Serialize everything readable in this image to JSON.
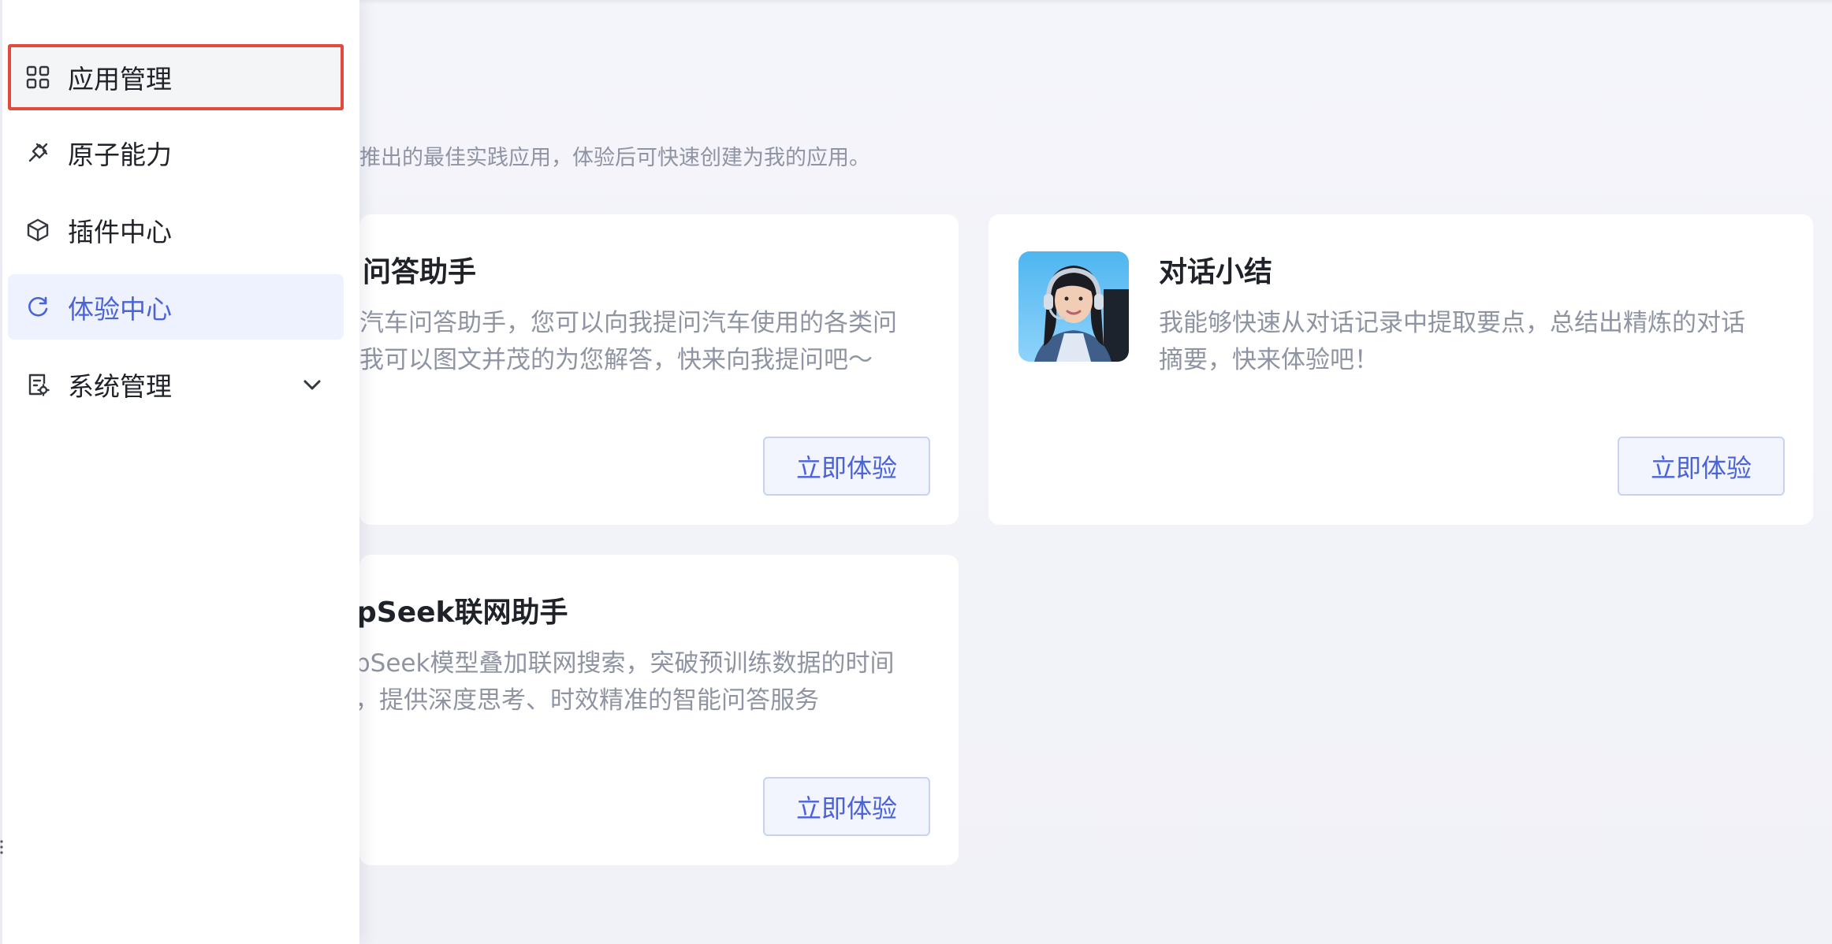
{
  "sidebar": {
    "items": [
      {
        "label": "应用管理",
        "icon": "grid-icon",
        "state": "highlighted"
      },
      {
        "label": "原子能力",
        "icon": "plug-icon",
        "state": "normal"
      },
      {
        "label": "插件中心",
        "icon": "cube-icon",
        "state": "normal"
      },
      {
        "label": "体验中心",
        "icon": "refresh-icon",
        "state": "active"
      },
      {
        "label": "系统管理",
        "icon": "settings-doc-icon",
        "state": "normal",
        "expandable": true
      }
    ]
  },
  "main": {
    "subtitle": "推出的最佳实践应用，体验后可快速创建为我的应用。",
    "cards": [
      {
        "title": "问答助手",
        "desc_line1": "汽车问答助手，您可以向我提问汽车使用的各类问",
        "desc_line2": "我可以图文并茂的为您解答，快来向我提问吧～",
        "button": "立即体验"
      },
      {
        "title": "对话小结",
        "desc_line1": "我能够快速从对话记录中提取要点，总结出精炼的对话",
        "desc_line2": "摘要，快来体验吧！",
        "button": "立即体验",
        "avatar": "customer-service-agent-avatar"
      },
      {
        "title": "pSeek联网助手",
        "desc_line1": "pSeek模型叠加联网搜索，突破预训练数据的时间",
        "desc_line2": "，提供深度思考、时效精准的智能问答服务",
        "button": "立即体验"
      }
    ]
  },
  "colors": {
    "accent": "#4b63d8",
    "active_bg": "#eef1fe",
    "highlight_border": "#e24b3b",
    "page_bg": "#f3f4f9",
    "muted_text": "#8f94a3"
  }
}
